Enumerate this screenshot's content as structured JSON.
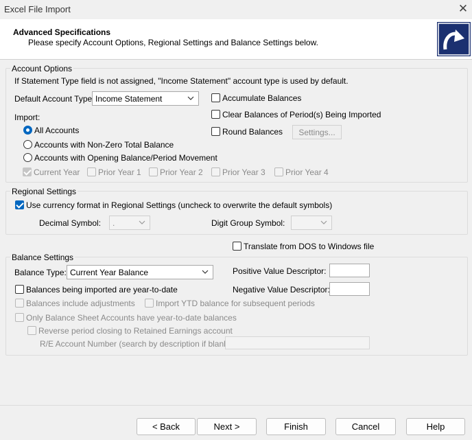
{
  "window": {
    "title": "Excel File Import",
    "close_glyph": "✕"
  },
  "header": {
    "title": "Advanced Specifications",
    "subtitle": "Please specify Account Options, Regional Settings and Balance Settings below.",
    "logo_icon": "curved-arrow-icon",
    "logo_color": "#1b3070"
  },
  "account_options": {
    "legend": "Account Options",
    "note": "If Statement Type field is not assigned, \"Income Statement\" account type is used by default.",
    "default_type_label": "Default Account Type:",
    "default_type_value": "Income Statement",
    "import_label": "Import:",
    "import_options": [
      {
        "label": "All Accounts",
        "checked": true
      },
      {
        "label": "Accounts with Non-Zero Total Balance",
        "checked": false
      },
      {
        "label": "Accounts with Opening Balance/Period Movement",
        "checked": false
      }
    ],
    "years": [
      {
        "label": "Current Year",
        "checked": true
      },
      {
        "label": "Prior Year 1",
        "checked": false
      },
      {
        "label": "Prior Year 2",
        "checked": false
      },
      {
        "label": "Prior Year 3",
        "checked": false
      },
      {
        "label": "Prior Year 4",
        "checked": false
      }
    ],
    "accumulate": "Accumulate Balances",
    "clear": "Clear Balances of Period(s) Being Imported",
    "round": "Round Balances",
    "settings_button": "Settings..."
  },
  "regional": {
    "legend": "Regional Settings",
    "use_currency": "Use currency format in Regional Settings (uncheck to overwrite the default symbols)",
    "use_currency_checked": true,
    "decimal_label": "Decimal Symbol:",
    "decimal_value": ".",
    "digit_label": "Digit Group Symbol:",
    "digit_value": ""
  },
  "translate": "Translate from DOS to Windows file",
  "balance": {
    "legend": "Balance Settings",
    "type_label": "Balance Type:",
    "type_value": "Current Year Balance",
    "ytd": "Balances being imported are year-to-date",
    "include_adj": "Balances include adjustments",
    "import_ytd": "Import YTD balance for subsequent periods",
    "only_bs": "Only Balance Sheet Accounts have year-to-date balances",
    "reverse": "Reverse period closing to Retained Earnings account",
    "re_label": "R/E Account Number (search by description if blank):",
    "positive_label": "Positive Value Descriptor:",
    "negative_label": "Negative Value Descriptor:"
  },
  "buttons": {
    "back": "< Back",
    "next": "Next >",
    "finish": "Finish",
    "cancel": "Cancel",
    "help": "Help"
  },
  "colors": {
    "accent": "#0067c0",
    "disabled_text": "#8a8a8a"
  }
}
